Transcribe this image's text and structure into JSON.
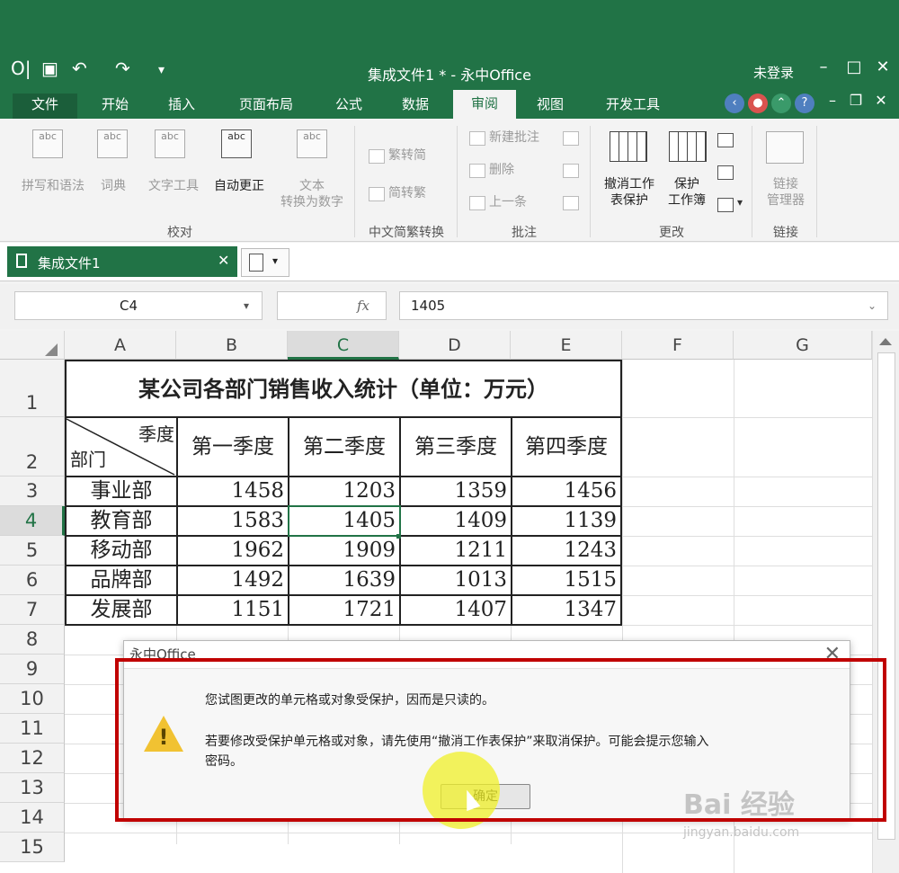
{
  "window": {
    "title": "集成文件1 * - 永中Office",
    "login": "未登录",
    "controls": [
      "–",
      "□",
      "✕"
    ]
  },
  "tabs": [
    {
      "label": "文件"
    },
    {
      "label": "开始"
    },
    {
      "label": "插入"
    },
    {
      "label": "页面布局"
    },
    {
      "label": "公式"
    },
    {
      "label": "数据"
    },
    {
      "label": "审阅"
    },
    {
      "label": "视图"
    },
    {
      "label": "开发工具"
    }
  ],
  "ribbon": {
    "spelling": "拼写和语法",
    "dictionary": "词典",
    "text_tool": "文字工具",
    "autocorrect": "自动更正",
    "text_to_num_1": "文本",
    "text_to_num_2": "转换为数字",
    "group_proof": "校对",
    "trad": "繁转简",
    "simp": "简转繁",
    "group_chinese": "中文简繁转换",
    "new_comment": "新建批注",
    "delete": "删除",
    "prev": "上一条",
    "group_comment": "批注",
    "unprotect_1": "撤消工作",
    "unprotect_2": "表保护",
    "protect_1": "保护",
    "protect_2": "工作簿",
    "group_change": "更改",
    "link_mgr_1": "链接",
    "link_mgr_2": "管理器",
    "group_link": "链接",
    "icon_abc": "abc"
  },
  "document": {
    "tab_label": "集成文件1",
    "close": "✕"
  },
  "formula": {
    "cell_ref": "C4",
    "fx": "fx",
    "value": "1405"
  },
  "grid": {
    "columns": [
      "A",
      "B",
      "C",
      "D",
      "E",
      "F",
      "G"
    ],
    "rows": [
      "1",
      "2",
      "3",
      "4",
      "5",
      "6",
      "7",
      "8",
      "9",
      "10",
      "11",
      "12",
      "13",
      "14",
      "15"
    ],
    "title": "某公司各部门销售收入统计（单位：万元）",
    "corner_top": "季度",
    "corner_bottom": "部门",
    "headers": [
      "第一季度",
      "第二季度",
      "第三季度",
      "第四季度"
    ],
    "data": [
      {
        "dept": "事业部",
        "values": [
          "1458",
          "1203",
          "1359",
          "1456"
        ]
      },
      {
        "dept": "教育部",
        "values": [
          "1583",
          "1405",
          "1409",
          "1139"
        ]
      },
      {
        "dept": "移动部",
        "values": [
          "1962",
          "1909",
          "1211",
          "1243"
        ]
      },
      {
        "dept": "品牌部",
        "values": [
          "1492",
          "1639",
          "1013",
          "1515"
        ]
      },
      {
        "dept": "发展部",
        "values": [
          "1151",
          "1721",
          "1407",
          "1347"
        ]
      }
    ]
  },
  "dialog": {
    "title": "永中Office",
    "close": "✕",
    "message_1": "您试图更改的单元格或对象受保护，因而是只读的。",
    "message_2": "若要修改受保护单元格或对象，请先使用“撤消工作表保护”来取消保护。可能会提示您输入",
    "message_3": "密码。",
    "ok": "确定"
  },
  "watermark": {
    "brand": "Bai 经验",
    "url": "jingyan.baidu.com"
  }
}
